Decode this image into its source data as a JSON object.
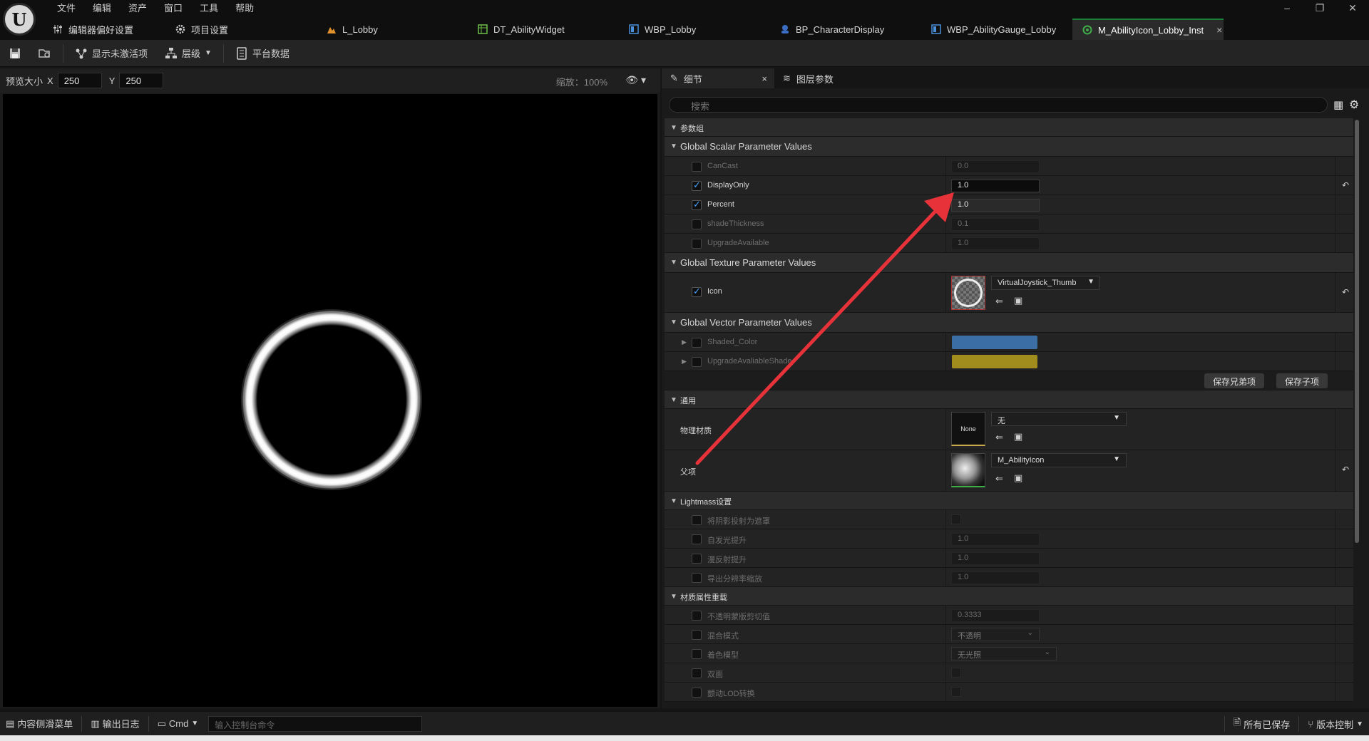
{
  "menu": [
    "文件",
    "编辑",
    "资产",
    "窗口",
    "工具",
    "帮助"
  ],
  "logo_letter": "U",
  "tabs": [
    {
      "label": "编辑器偏好设置",
      "icon": "sliders-icon"
    },
    {
      "label": "项目设置",
      "icon": "gear-icon"
    },
    {
      "label": "L_Lobby",
      "icon": "level-icon"
    },
    {
      "label": "DT_AbilityWidget",
      "icon": "datatable-icon"
    },
    {
      "label": "WBP_Lobby",
      "icon": "widget-blueprint-icon"
    },
    {
      "label": "BP_CharacterDisplay",
      "icon": "blueprint-icon"
    },
    {
      "label": "WBP_AbilityGauge_Lobby",
      "icon": "widget-blueprint-icon"
    },
    {
      "label": "M_AbilityIcon_Lobby_Inst",
      "icon": "material-instance-icon",
      "close": "×"
    }
  ],
  "window_controls": {
    "minimize": "–",
    "restore": "❐",
    "close": "✕"
  },
  "toolbar": {
    "show_inactive": "显示未激活项",
    "hierarchy": "层级",
    "platform_data": "平台数据"
  },
  "viewport": {
    "preview_size_label": "预览大小",
    "x_label": "X",
    "x_value": "250",
    "y_label": "Y",
    "y_value": "250",
    "zoom": "缩放：100%"
  },
  "details": {
    "tab_details": "细节",
    "tab_layer_params": "图层参数",
    "tab_close": "×",
    "search_placeholder": "搜索",
    "group_params": "参数组",
    "scalar_header": "Global Scalar Parameter Values",
    "scalars": [
      {
        "name": "CanCast",
        "value": "0.0",
        "checked": false
      },
      {
        "name": "DisplayOnly",
        "value": "1.0",
        "checked": true
      },
      {
        "name": "Percent",
        "value": "1.0",
        "checked": true
      },
      {
        "name": "shadeThickness",
        "value": "0.1",
        "checked": false
      },
      {
        "name": "UpgradeAvailable",
        "value": "1.0",
        "checked": false
      }
    ],
    "texture_header": "Global Texture Parameter Values",
    "texture": {
      "name": "Icon",
      "value": "VirtualJoystick_Thumb",
      "checked": true
    },
    "vector_header": "Global Vector Parameter Values",
    "vectors": [
      {
        "name": "Shaded_Color",
        "color": "#3a6ea5"
      },
      {
        "name": "UpgradeAvaliableShade",
        "color": "#a08d1e"
      }
    ],
    "save_siblings": "保存兄弟项",
    "save_children": "保存子项",
    "general_header": "通用",
    "phys_material_label": "物理材质",
    "phys_material_thumb": "None",
    "phys_material_value": "无",
    "parent_label": "父项",
    "parent_value": "M_AbilityIcon",
    "lightmass_header": "Lightmass设置",
    "lightmass": [
      {
        "name": "将阴影投射为遮罩",
        "type": "checkbox"
      },
      {
        "name": "自发光提升",
        "type": "value",
        "value": "1.0"
      },
      {
        "name": "漫反射提升",
        "type": "value",
        "value": "1.0"
      },
      {
        "name": "导出分辨率缩放",
        "type": "value",
        "value": "1.0"
      }
    ],
    "override_header": "材质属性重载",
    "overrides": [
      {
        "name": "不透明蒙版剪切值",
        "type": "value",
        "value": "0.3333"
      },
      {
        "name": "混合模式",
        "type": "dropdown",
        "value": "不透明"
      },
      {
        "name": "着色模型",
        "type": "dropdown",
        "value": "无光照"
      },
      {
        "name": "双面",
        "type": "checkbox"
      },
      {
        "name": "颤动LOD转换",
        "type": "checkbox"
      }
    ]
  },
  "statusbar": {
    "content_drawer": "内容侧滑菜单",
    "output_log": "输出日志",
    "cmd": "Cmd",
    "console_placeholder": "输入控制台命令",
    "all_saved": "所有已保存",
    "source_control": "版本控制"
  },
  "colors": {
    "accent_green": "#1a7f37",
    "annotation_arrow": "#e8323a",
    "checkbox_blue": "#4aa3ff"
  }
}
